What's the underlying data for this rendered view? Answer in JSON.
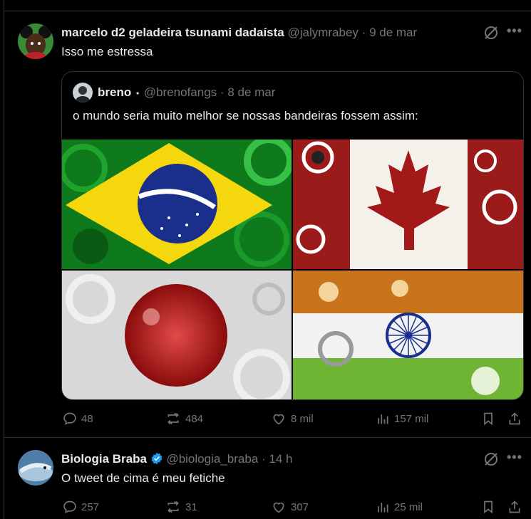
{
  "tweets": [
    {
      "author_name": "marcelo d2 geladeira tsunami dadaísta",
      "handle": "@jalymrabey",
      "separator": "·",
      "date": "9 de mar",
      "text": "Isso me estressa",
      "quote": {
        "author_name": "breno",
        "badge": "⋆",
        "handle": "@brenofangs",
        "separator": "·",
        "date": "8 de mar",
        "text": "o mundo seria muito melhor se nossas bandeiras fossem assim:",
        "images": [
          "brazil-flag",
          "canada-flag",
          "japan-flag",
          "india-flag"
        ]
      },
      "actions": {
        "replies": "48",
        "reposts": "484",
        "likes": "8 mil",
        "views": "157 mil"
      }
    },
    {
      "author_name": "Biologia Braba",
      "verified": true,
      "handle": "@biologia_braba",
      "separator": "·",
      "date": "14 h",
      "text": "O tweet de cima é meu fetiche",
      "actions": {
        "replies": "257",
        "reposts": "31",
        "likes": "307",
        "views": "25 mil"
      }
    }
  ],
  "colors": {
    "background": "#000000",
    "text": "#e7e9ea",
    "muted": "#71767b",
    "border": "#2f3336",
    "verified": "#1d9bf0"
  },
  "icons": {
    "more": "•••",
    "grok": "grok-icon"
  }
}
